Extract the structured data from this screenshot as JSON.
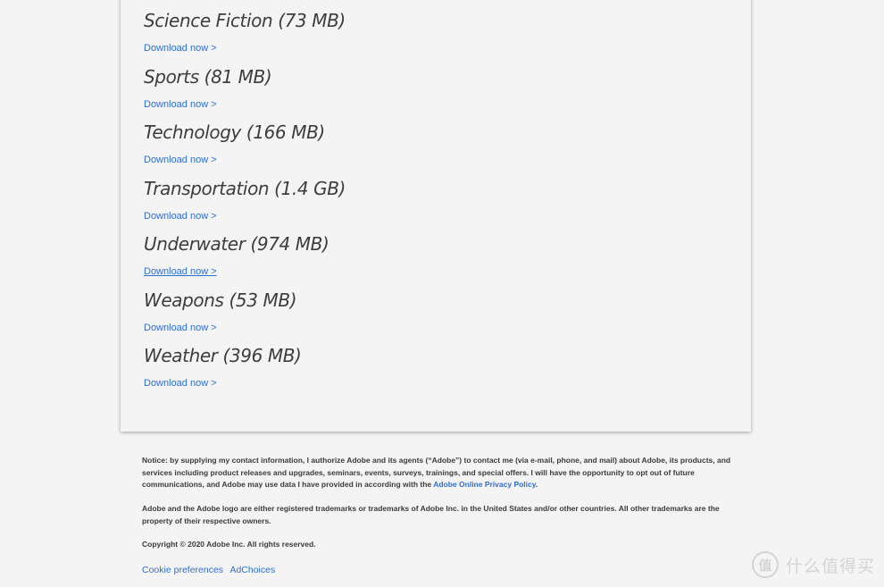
{
  "categories": [
    {
      "title": "Science Fiction (73 MB)",
      "link": "Download now >"
    },
    {
      "title": "Sports (81 MB)",
      "link": "Download now >"
    },
    {
      "title": "Technology (166 MB)",
      "link": "Download now >"
    },
    {
      "title": "Transportation (1.4 GB)",
      "link": "Download now >"
    },
    {
      "title": "Underwater (974 MB)",
      "link": "Download now >"
    },
    {
      "title": "Weapons (53 MB)",
      "link": "Download now >"
    },
    {
      "title": "Weather (396 MB)",
      "link": "Download now >"
    }
  ],
  "footer": {
    "notice_text": "Notice: by supplying my contact information, I authorize Adobe and its agents (“Adobe”) to contact me (via e-mail, phone, and mail) about Adobe, its products, and services including product releases and upgrades, seminars, events, surveys, trainings, and special offers. I will have the opportunity to opt out of future communications, and Adobe may use data I have provided in according with the ",
    "privacy_link": "Adobe Online Privacy Policy",
    "notice_end": ".",
    "trademark": "Adobe and the Adobe logo are either registered trademarks or trademarks of Adobe Inc. in the United States and/or other countries. All other trademarks are the property of their respective owners.",
    "copyright": "Copyright © 2020 Adobe Inc. All rights reserved.",
    "cookie_link": "Cookie preferences",
    "adchoices_link": "AdChoices"
  },
  "watermark": {
    "logo_glyph": "值",
    "text": "什么值得买"
  },
  "colors": {
    "link": "#2d6ed3",
    "background": "#f4f4f4",
    "heading": "#3d3d3d"
  }
}
